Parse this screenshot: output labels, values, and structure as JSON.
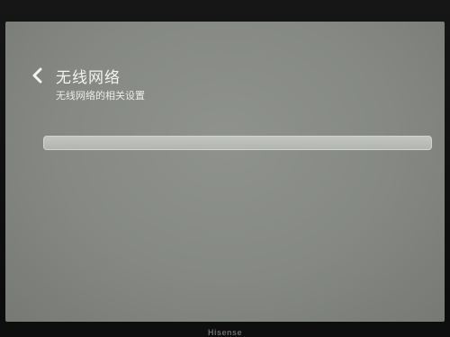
{
  "screen": {
    "title": "无线网络",
    "subtitle": "无线网络的相关设置",
    "back_icon": "chevron-left-icon"
  },
  "tv": {
    "brand": "Hisense"
  },
  "colors": {
    "screen_bg": "#878a85",
    "text": "#f4f4f1",
    "bar": "#bcbeb9"
  }
}
